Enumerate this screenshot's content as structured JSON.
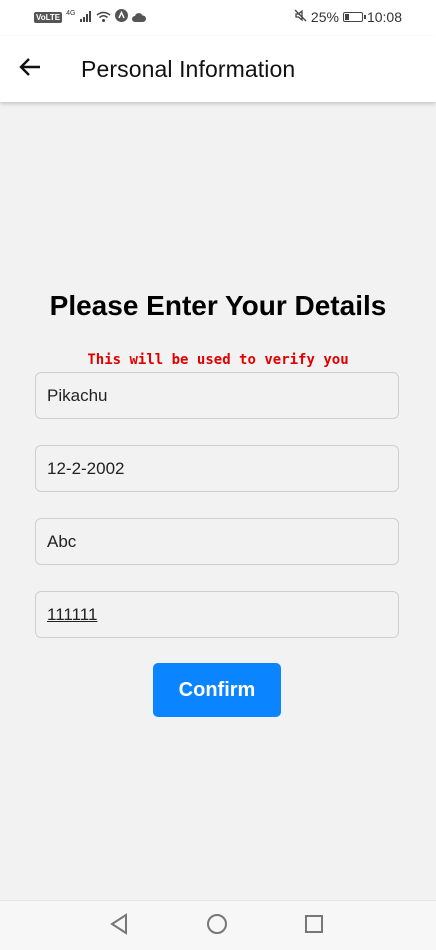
{
  "status_bar": {
    "volte": "VoLTE",
    "network": "4G",
    "battery_percent": "25%",
    "battery_level": 0.25,
    "time": "10:08"
  },
  "app_bar": {
    "back_icon": "arrow-left-icon",
    "title": "Personal Information"
  },
  "form": {
    "heading": "Please Enter Your Details",
    "subtitle": "This will be used to verify you",
    "fields": [
      {
        "value": "Pikachu"
      },
      {
        "value": "12-2-2002"
      },
      {
        "value": "Abc"
      },
      {
        "value": "111111"
      }
    ],
    "confirm_label": "Confirm",
    "accent_color": "#0a84ff",
    "subtitle_color": "#e00000"
  },
  "nav_bar": {
    "back_icon": "triangle-back-icon",
    "home_icon": "circle-home-icon",
    "recents_icon": "square-recents-icon"
  }
}
